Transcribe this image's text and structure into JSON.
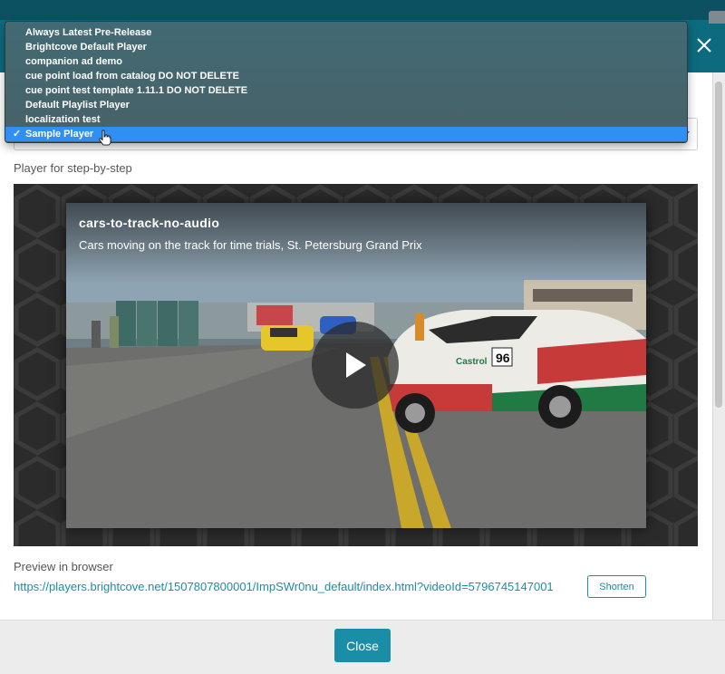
{
  "dropdown": {
    "options": [
      "Always Latest Pre-Release",
      "Brightcove Default Player",
      "companion ad demo",
      "cue point load from catalog DO NOT DELETE",
      "cue point test template 1.11.1 DO NOT DELETE",
      "Default Playlist Player",
      "localization test",
      "Sample Player"
    ],
    "selected_index": 7,
    "selected_value": "Sample Player"
  },
  "player_label": "Player for step-by-step",
  "video": {
    "title": "cars-to-track-no-audio",
    "description": "Cars moving on the track for time trials, St. Petersburg Grand Prix",
    "car_number": "96",
    "car_sponsor": "Castrol"
  },
  "preview": {
    "label": "Preview in browser",
    "url": "https://players.brightcove.net/1507807800001/ImpSWr0nu_default/index.html?videoId=5796745147001",
    "shorten_label": "Shorten"
  },
  "footer": {
    "close_label": "Close"
  },
  "colors": {
    "accent": "#1a8ea6",
    "header": "#0d6b80",
    "selection": "#2f8ff2"
  },
  "icons": {
    "close": "close-icon",
    "play": "play-icon",
    "check": "checkmark-icon",
    "cursor": "hand-cursor-icon",
    "caret": "caret-down-icon"
  }
}
